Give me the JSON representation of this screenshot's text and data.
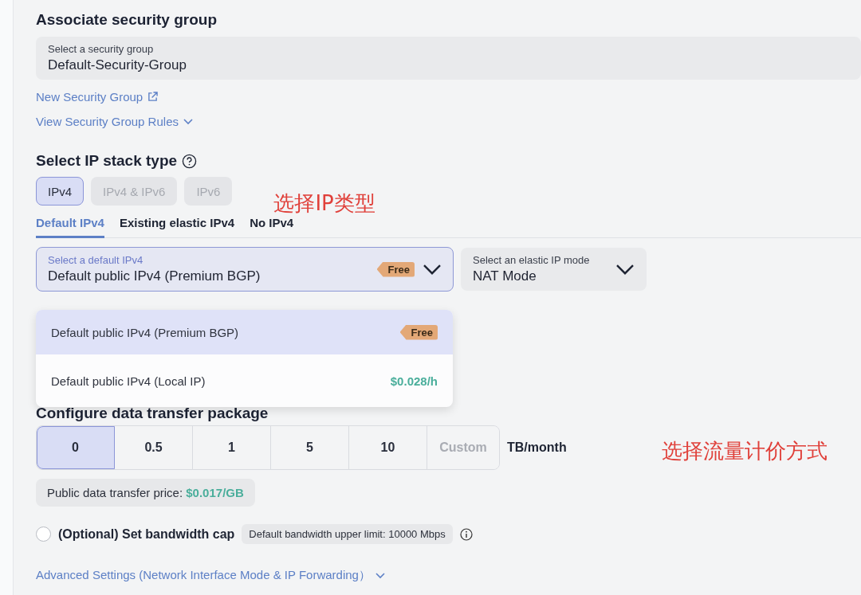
{
  "security_group": {
    "heading": "Associate security group",
    "field": {
      "label": "Select a security group",
      "value": "Default-Security-Group"
    },
    "new_link": "New Security Group",
    "rules_link": "View Security Group Rules"
  },
  "ip_stack": {
    "heading": "Select IP stack type",
    "options": [
      {
        "label": "IPv4",
        "selected": true,
        "disabled": false
      },
      {
        "label": "IPv4 & IPv6",
        "selected": false,
        "disabled": true
      },
      {
        "label": "IPv6",
        "selected": false,
        "disabled": true
      }
    ],
    "annotation": "选择IP类型"
  },
  "tabs": [
    {
      "label": "Default IPv4",
      "selected": true
    },
    {
      "label": "Existing elastic IPv4",
      "selected": false
    },
    {
      "label": "No IPv4",
      "selected": false
    }
  ],
  "ipv4_select": {
    "label": "Select a default IPv4",
    "value": "Default public IPv4 (Premium BGP)",
    "badge": "Free",
    "expanded": true,
    "options": [
      {
        "label": "Default public IPv4 (Premium BGP)",
        "kind": "badge",
        "tag": "Free",
        "selected": true
      },
      {
        "label": "Default public IPv4 (Local IP)",
        "kind": "price",
        "tag": "$0.028/h",
        "selected": false
      }
    ]
  },
  "mode_select": {
    "label": "Select an elastic IP mode",
    "value": "NAT Mode"
  },
  "transfer": {
    "heading": "Configure data transfer package",
    "options": [
      {
        "label": "0",
        "selected": true
      },
      {
        "label": "0.5",
        "selected": false
      },
      {
        "label": "1",
        "selected": false
      },
      {
        "label": "5",
        "selected": false
      },
      {
        "label": "10",
        "selected": false
      }
    ],
    "custom_placeholder": "Custom",
    "unit": "TB/month",
    "annotation": "选择流量计价方式",
    "price_note": "Public data transfer price: ",
    "price": "$0.017/GB"
  },
  "bandwidth": {
    "checked": false,
    "label": "(Optional) Set bandwidth cap",
    "hint": "Default bandwidth upper limit: 10000 Mbps"
  },
  "advanced_link": "Advanced Settings (Network Interface Mode & IP Forwarding）"
}
